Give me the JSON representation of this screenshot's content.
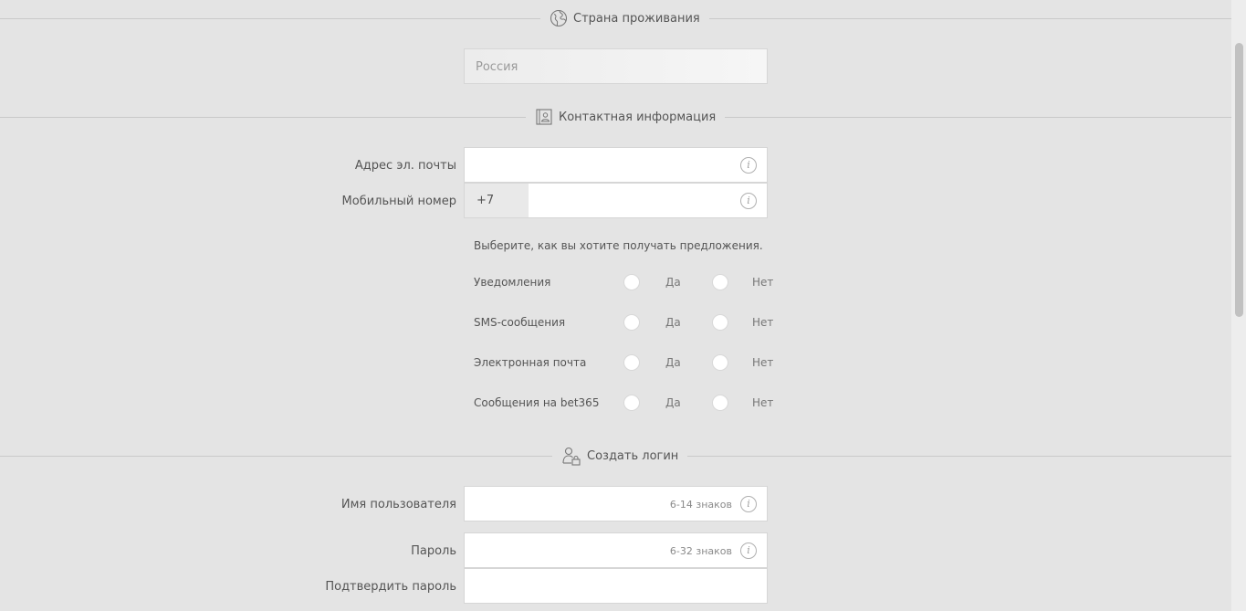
{
  "sections": {
    "country": {
      "title": "Страна проживания",
      "icon": "globe-icon"
    },
    "contact": {
      "title": "Контактная информация",
      "icon": "contact-book-icon"
    },
    "login": {
      "title": "Создать логин",
      "icon": "user-lock-icon"
    }
  },
  "country_field": {
    "value": "Россия"
  },
  "contact_fields": {
    "email_label": "Адрес эл. почты",
    "mobile_label": "Мобильный номер",
    "mobile_prefix": "+7",
    "info_glyph": "i"
  },
  "preferences": {
    "prompt": "Выберите, как вы хотите получать предложения.",
    "yes_label": "Да",
    "no_label": "Нет",
    "rows": [
      {
        "label": "Уведомления"
      },
      {
        "label": "SMS-сообщения"
      },
      {
        "label": "Электронная почта"
      },
      {
        "label": "Сообщения на bet365"
      }
    ]
  },
  "login_fields": {
    "username_label": "Имя пользователя",
    "username_hint": "6-14 знаков",
    "password_label": "Пароль",
    "password_hint": "6-32 знаков",
    "confirm_label": "Подтвердить пароль"
  }
}
